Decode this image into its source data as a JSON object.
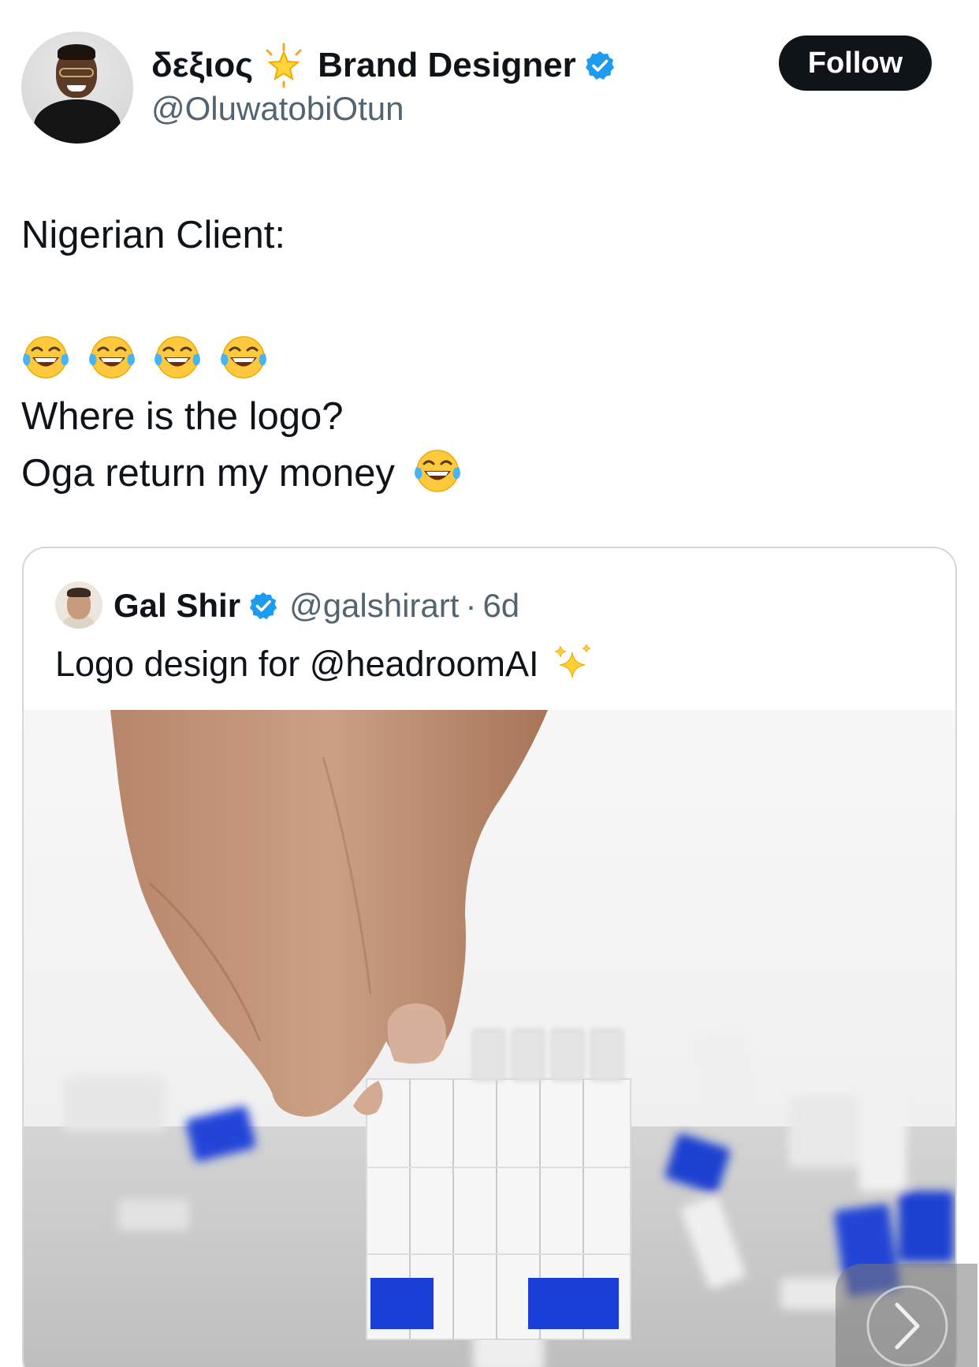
{
  "author": {
    "name": "δεξιος",
    "name_emoji_icon": "glowing-star-icon",
    "title": "Brand Designer",
    "verified_icon": "verified-badge-icon",
    "handle": "@OluwatobiOtun",
    "follow_label": "Follow"
  },
  "tweet": {
    "line1": "Nigerian Client:",
    "emoji_row_icons": [
      "face-with-tears-of-joy-icon",
      "face-with-tears-of-joy-icon",
      "face-with-tears-of-joy-icon",
      "face-with-tears-of-joy-icon"
    ],
    "line3": "Where is the logo?",
    "line4": "Oga return my money",
    "line4_emoji_icon": "face-with-tears-of-joy-icon"
  },
  "quoted_tweet": {
    "name": "Gal Shir",
    "handle": "@galshirart",
    "separator": "·",
    "time": "6d",
    "text": "Logo design for @headroomAI",
    "text_emoji_icon": "sparkles-icon",
    "media_description_icon": "video-thumbnail-lego-icon"
  },
  "colors": {
    "text_primary": "#0f1419",
    "text_secondary": "#536471",
    "verified_blue": "#1d9bf0",
    "border": "#cfd9de",
    "lego_blue": "#1a3fd6"
  }
}
